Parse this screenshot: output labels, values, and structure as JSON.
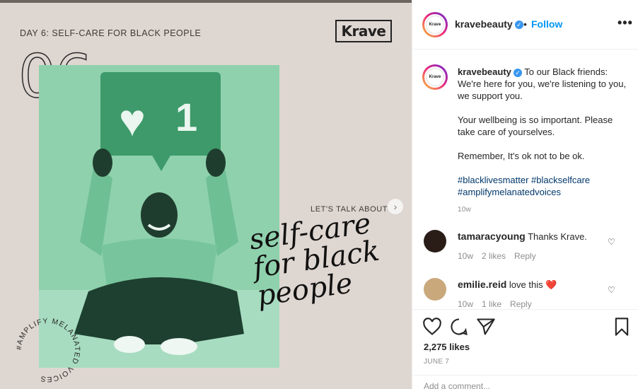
{
  "image": {
    "day_label": "DAY 6: SELF-CARE FOR BLACK PEOPLE",
    "brand_logo": "Krave",
    "big_number": "06",
    "like_count_sign": "1",
    "next_label": "LET'S TALK ABOUT",
    "script_line1": "self-care",
    "script_line2": "for black",
    "script_line3": "people",
    "circle_text": "#AMPLIFY MELANATED VOICES"
  },
  "header": {
    "username": "kravebeauty",
    "avatar_text": "Krave",
    "separator": "•",
    "follow_label": "Follow",
    "more_label": "•••"
  },
  "caption": {
    "username": "kravebeauty",
    "line1": "To our Black friends: We're here for you, we're listening to you, we support you.",
    "line2": "Your wellbeing is so important. Please take care of yourselves.",
    "line3": "Remember, It's ok not to be ok.",
    "hashtags": "#blacklivesmatter #blackselfcare #amplifymelanatedvoices",
    "time": "10w"
  },
  "comments": [
    {
      "username": "tamaracyoung",
      "text": "Thanks Krave.",
      "time": "10w",
      "likes": "2 likes",
      "reply": "Reply"
    },
    {
      "username": "emilie.reid",
      "text": "love this ❤️",
      "time": "10w",
      "likes": "1 like",
      "reply": "Reply"
    }
  ],
  "actions": {
    "likes": "2,275 likes",
    "date": "JUNE 7",
    "add_comment_placeholder": "Add a comment..."
  },
  "colors": {
    "accent": "#0095f6",
    "photo_green": "#8fd1ad",
    "background": "#ded6d1"
  }
}
